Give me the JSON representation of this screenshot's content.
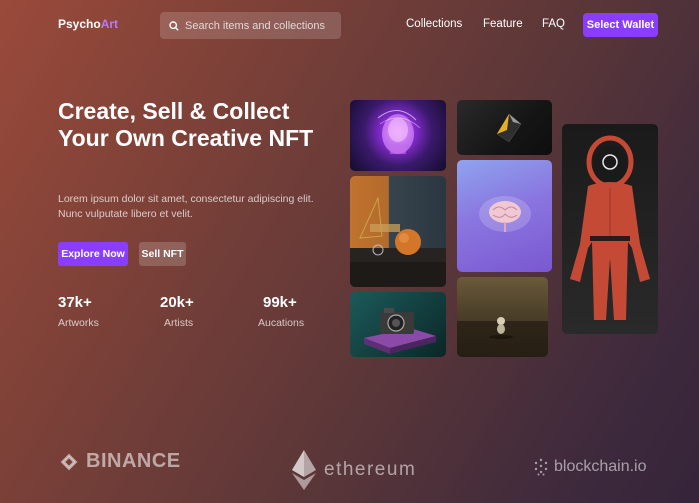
{
  "header": {
    "logo_main": "Psycho",
    "logo_accent": "Art",
    "search_placeholder": "Search items and collections",
    "nav": [
      "Collections",
      "Feature",
      "FAQ"
    ],
    "wallet_button": "Select Wallet"
  },
  "hero": {
    "title": "Create, Sell & Collect Your Own Creative NFT",
    "subtitle": "Lorem ipsum dolor sit amet, consectetur adipiscing elit. Nunc vulputate libero et velit.",
    "explore_button": "Explore Now",
    "sell_button": "Sell NFT",
    "stats": [
      {
        "value": "37k+",
        "label": "Artworks"
      },
      {
        "value": "20k+",
        "label": "Artists"
      },
      {
        "value": "99k+",
        "label": "Aucations"
      }
    ]
  },
  "gallery": {
    "icons": [
      "glitch-skull-art",
      "dark-diamond-art",
      "orange-sphere-art",
      "glowing-brain-art",
      "red-jumpsuit-figure-art",
      "camera-on-book-art",
      "misty-figure-art"
    ]
  },
  "partners": [
    "BINANCE",
    "ethereum",
    "blockchain.io"
  ],
  "colors": {
    "accent": "#8b3dff",
    "logo_accent": "#b57bff"
  }
}
